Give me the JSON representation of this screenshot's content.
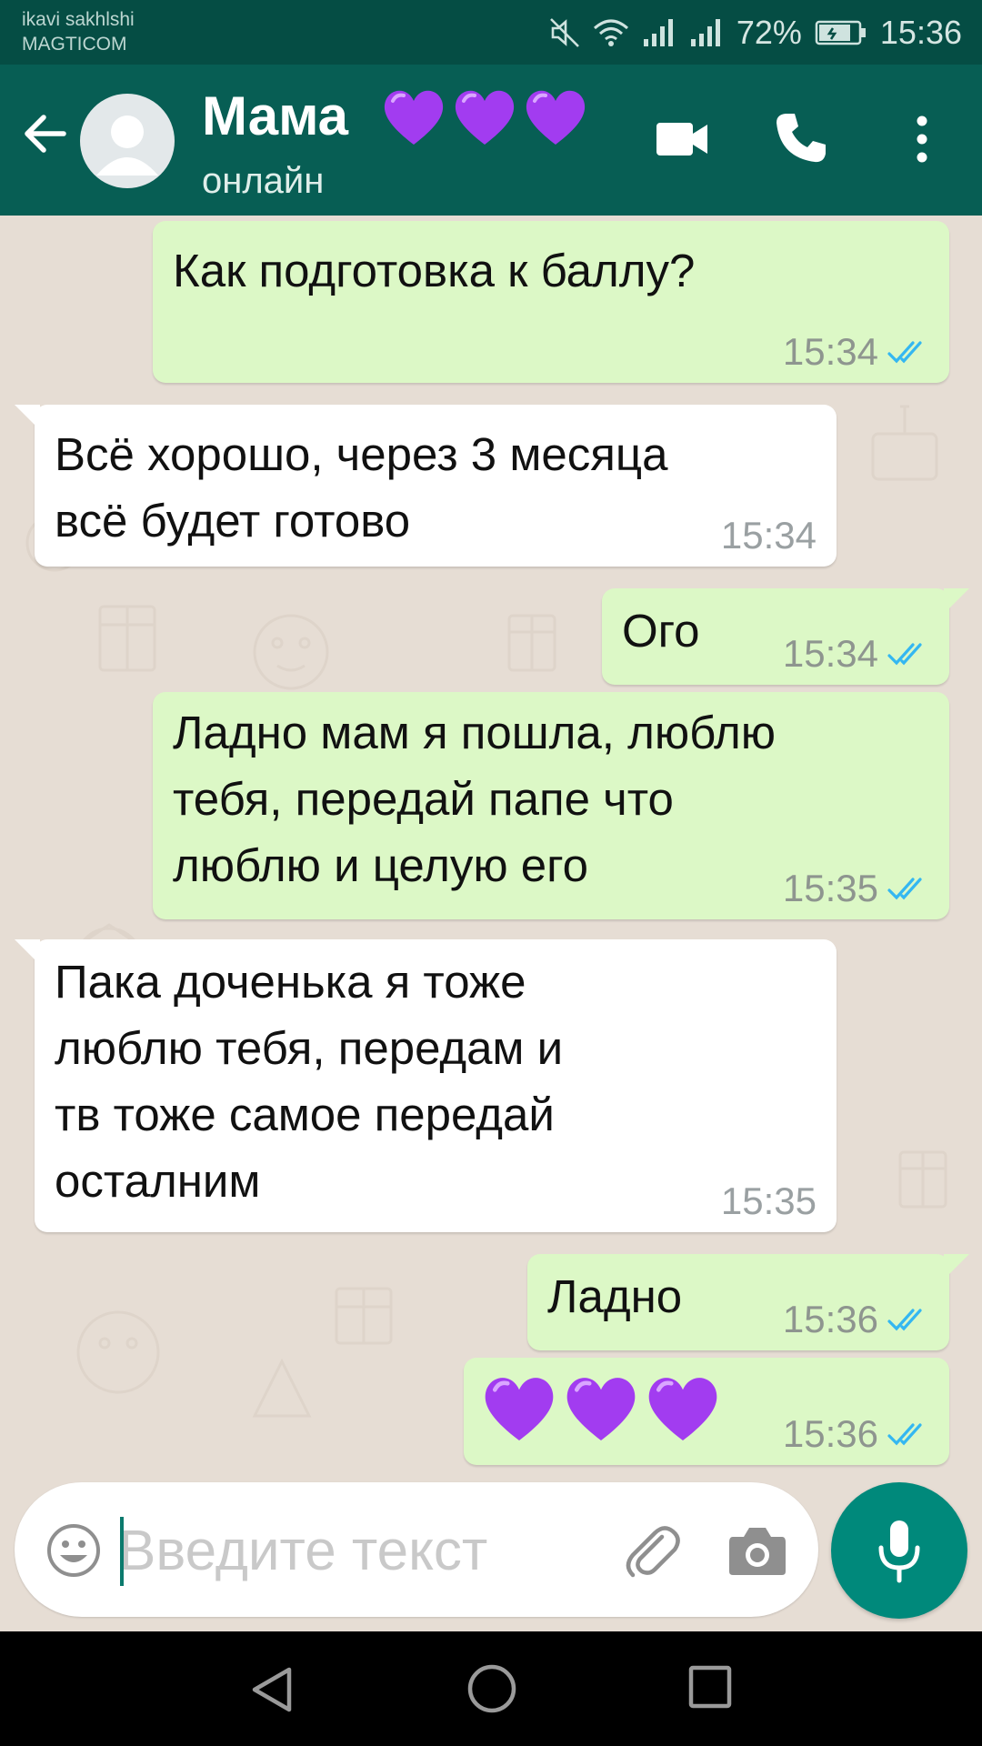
{
  "status_bar": {
    "carrier_line1": "ikavi sakhlshi",
    "carrier_line2": "MAGTICOM",
    "battery": "72%",
    "time": "15:36"
  },
  "header": {
    "contact_name": "Мама",
    "title_emoji": "💜💜💜",
    "status": "онлайн"
  },
  "messages": [
    {
      "dir": "out",
      "text": "Как подготовка к баллу?",
      "time": "15:34",
      "read": true
    },
    {
      "dir": "in",
      "text": "Всё хорошо, через 3 месяца\nвсё будет готово",
      "time": "15:34"
    },
    {
      "dir": "out",
      "text": "Ого",
      "time": "15:34",
      "read": true
    },
    {
      "dir": "out",
      "text": "Ладно мам я пошла, люблю\nтебя, передай папе что\nлюблю и целую его",
      "time": "15:35",
      "read": true
    },
    {
      "dir": "in",
      "text": "Пака доченька я тоже\nлюблю тебя, передам и\nтв тоже самое передай\nосталним",
      "time": "15:35"
    },
    {
      "dir": "out",
      "text": "Ладно",
      "time": "15:36",
      "read": true
    },
    {
      "dir": "out",
      "text": "💜💜💜",
      "time": "15:36",
      "read": true
    }
  ],
  "input": {
    "placeholder": "Введите текст"
  },
  "icons": {
    "back": "arrow-left-icon",
    "video": "video-camera-icon",
    "call": "phone-icon",
    "menu": "more-vert-icon",
    "emoji": "smiley-icon",
    "attach": "paperclip-icon",
    "camera": "camera-icon",
    "mic": "microphone-icon"
  },
  "colors": {
    "header": "#075e54",
    "status_bar": "#054d44",
    "outgoing_bubble": "#dcf8c6",
    "incoming_bubble": "#ffffff",
    "read_ticks": "#34b7f1",
    "mic_button": "#00897b",
    "heart": "#a23cf0"
  }
}
